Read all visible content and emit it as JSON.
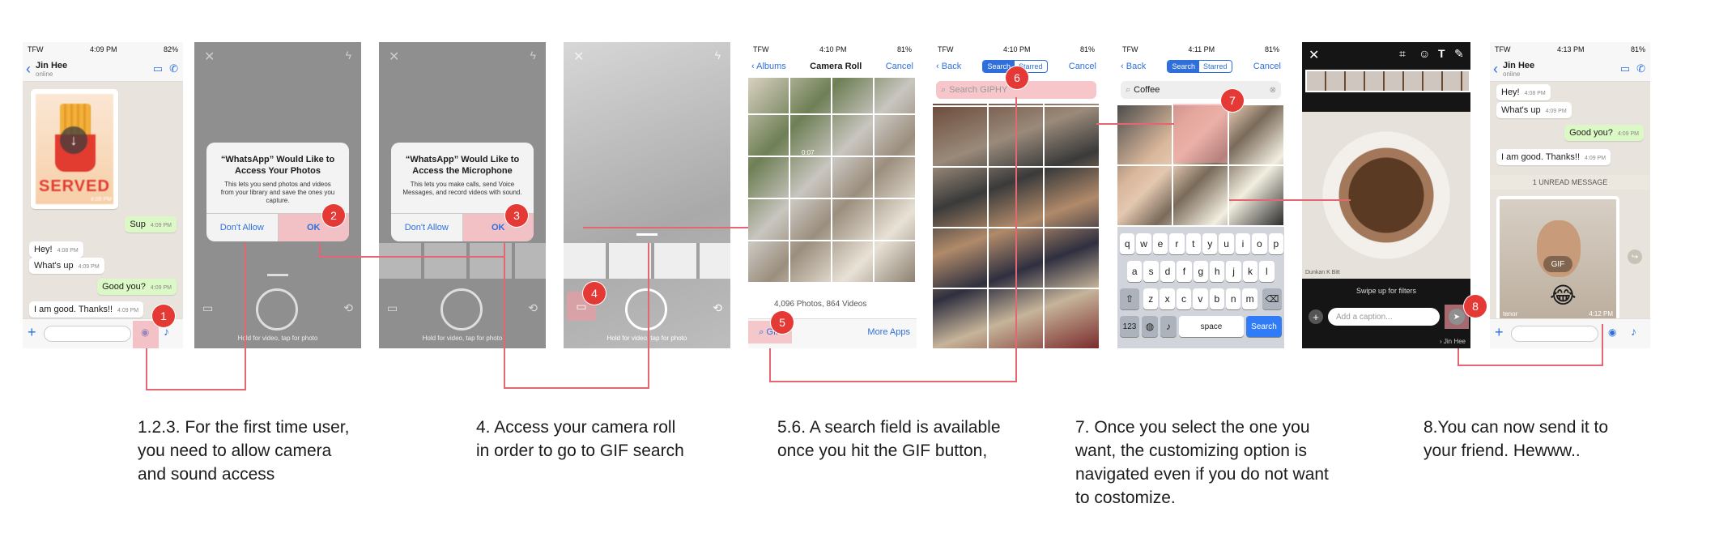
{
  "status": {
    "carrier": "TFW",
    "battery_82": "82%",
    "battery_81": "81%",
    "t1": "4:09 PM",
    "t4": "4:10 PM",
    "t6": "4:11 PM",
    "t8": "4:13 PM"
  },
  "chat": {
    "contact": "Jin Hee",
    "presence": "online",
    "image_badge": "SERVED",
    "image_time": "4:08 PM",
    "messages": [
      {
        "text": "Sup",
        "time": "4:09 PM",
        "dir": "out"
      },
      {
        "text": "Hey!",
        "time": "4:08 PM",
        "dir": "in"
      },
      {
        "text": "What's up",
        "time": "4:09 PM",
        "dir": "in"
      },
      {
        "text": "Good you?",
        "time": "4:09 PM",
        "dir": "out"
      },
      {
        "text": "I am good. Thanks!!",
        "time": "4:09 PM",
        "dir": "in"
      }
    ],
    "unread": "1 UNREAD MESSAGE",
    "gif_label": "GIF",
    "gif_time": "4:12 PM",
    "gif_source": "tenor"
  },
  "alerts": {
    "photos_title": "“WhatsApp” Would Like to Access Your Photos",
    "photos_msg": "This lets you send photos and videos from your library and save the ones you capture.",
    "mic_title": "“WhatsApp” Would Like to Access the Microphone",
    "mic_msg": "This lets you make calls, send Voice Messages, and record videos with sound.",
    "deny": "Don't Allow",
    "ok": "OK"
  },
  "camera": {
    "hint": "Hold for video, tap for photo"
  },
  "roll": {
    "back": "Albums",
    "title": "Camera Roll",
    "cancel": "Cancel",
    "count": "4,096 Photos, 864 Videos",
    "gif_button": "GIF",
    "more_apps": "More Apps",
    "video_len": "0:07"
  },
  "giphy": {
    "back": "Back",
    "tab_search": "Search",
    "tab_starred": "Starred",
    "cancel": "Cancel",
    "placeholder": "Search GIPHY",
    "query": "Coffee",
    "space": "space",
    "search_key": "Search",
    "num_key": "123"
  },
  "keyboard": {
    "row1": [
      "q",
      "w",
      "e",
      "r",
      "t",
      "y",
      "u",
      "i",
      "o",
      "p"
    ],
    "row2": [
      "a",
      "s",
      "d",
      "f",
      "g",
      "h",
      "j",
      "k",
      "l"
    ],
    "row3": [
      "z",
      "x",
      "c",
      "v",
      "b",
      "n",
      "m"
    ]
  },
  "editor": {
    "swipe": "Swipe up for filters",
    "caption_placeholder": "Add a caption...",
    "recipient": "Jin Hee",
    "watermark": "Dunkan K Bitt"
  },
  "steps": [
    "1",
    "2",
    "3",
    "4",
    "5",
    "6",
    "7",
    "8"
  ],
  "captions": [
    "1.2.3. For the first time user,\nyou need to allow camera\nand sound access",
    "4. Access your camera roll\nin order to go to GIF search",
    "5.6. A search field is available\nonce you hit the GIF button,",
    "7. Once you select the one you\nwant, the customizing option is\nnavigated even if you do not want\nto costomize.",
    "8.You can now send it to\nyour friend. Hewww.."
  ],
  "colors": {
    "accent": "#e53935",
    "link": "#2f6fdc",
    "bubble_out": "#dcf8c6",
    "chat_bg": "#e8e3dc"
  }
}
